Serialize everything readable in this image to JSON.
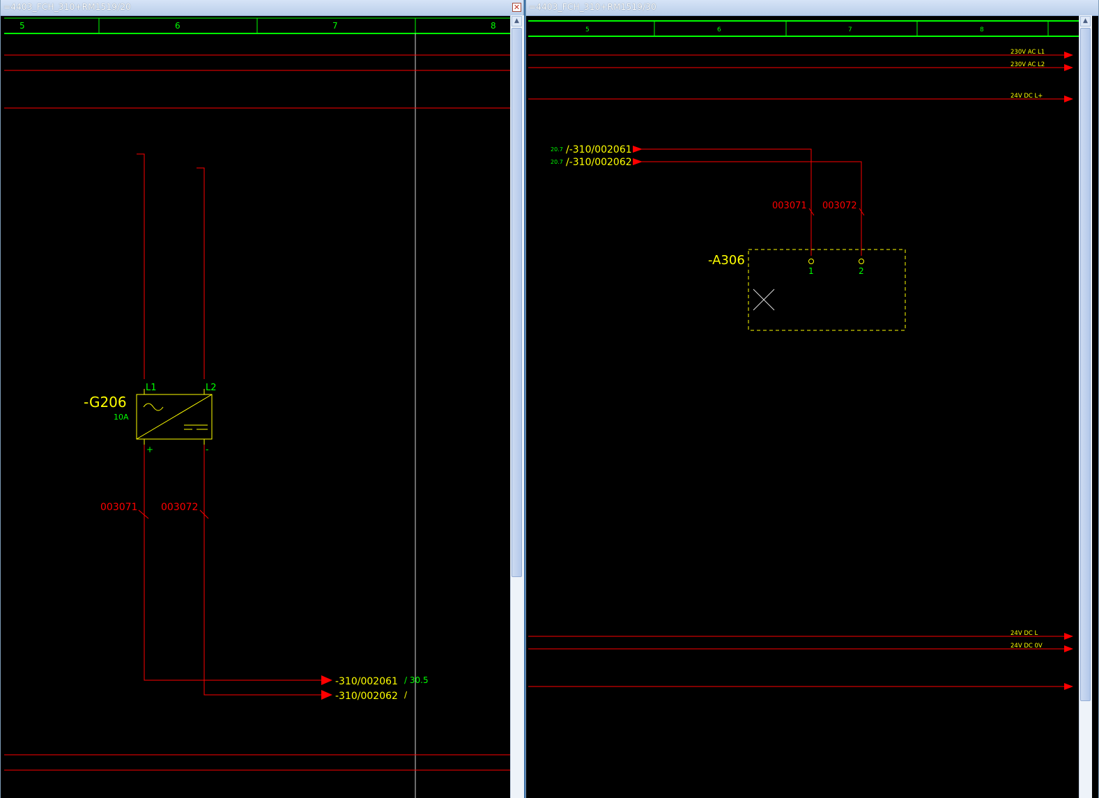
{
  "left_window": {
    "title": "=4403_FCH_310+RM1519/20",
    "columns": [
      "5",
      "6",
      "7",
      "8"
    ],
    "component": {
      "tag": "-G206",
      "rating": "10A",
      "term_l1": "L1",
      "term_l2": "L2",
      "term_plus": "+",
      "term_minus": "-"
    },
    "wires": [
      "003071",
      "003072"
    ],
    "outputs": [
      {
        "label": "-310/002061",
        "ref": "/ 30.5"
      },
      {
        "label": "-310/002062",
        "ref": "/"
      }
    ]
  },
  "right_window": {
    "title": "=4403_FCH_310+RM1519/30",
    "columns": [
      "5",
      "6",
      "7",
      "8"
    ],
    "rails_top": [
      "230V AC L1",
      "230V AC L2",
      "24V DC L+"
    ],
    "rails_bottom": [
      "24V DC L",
      "24V DC 0V"
    ],
    "inputs": [
      {
        "ref": "20.7",
        "label": "/-310/002061"
      },
      {
        "ref": "20.7",
        "label": "/-310/002062"
      }
    ],
    "wires": [
      "003071",
      "003072"
    ],
    "component": {
      "tag": "-A306",
      "pin1": "1",
      "pin2": "2"
    }
  },
  "colors": {
    "background": "#000000",
    "wire": "#ff0000",
    "frame": "#00ff00",
    "symbol": "#ffff00",
    "terminal_text": "#00ff00",
    "wire_text": "#ff0000"
  },
  "icons": [
    "close-icon",
    "scroll-up-icon",
    "scroll-down-icon"
  ]
}
